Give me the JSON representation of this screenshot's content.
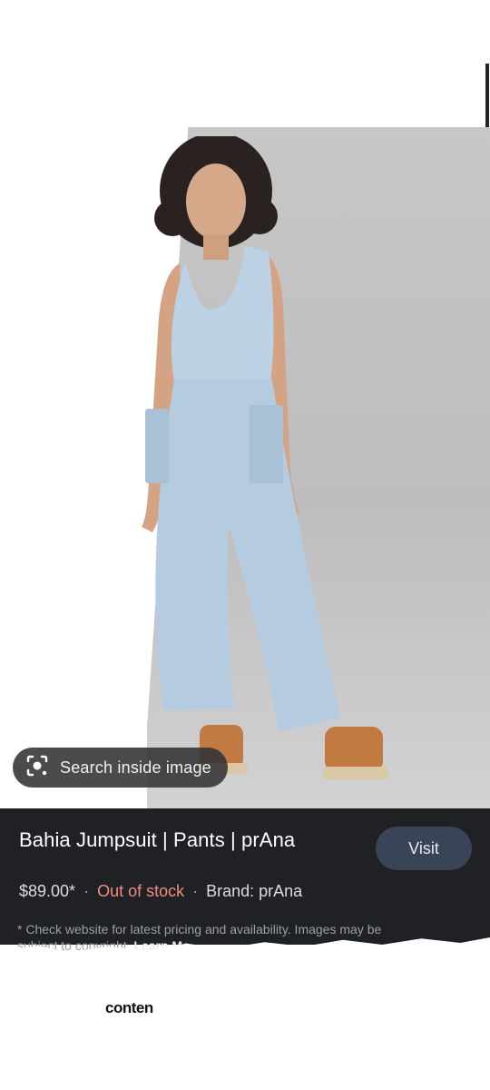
{
  "search_inside": {
    "label": "Search inside image",
    "icon": "lens-icon"
  },
  "product": {
    "title": "Bahia Jumpsuit | Pants | prAna",
    "price": "$89.00*",
    "stock": "Out of stock",
    "brand": "Brand: prAna",
    "visit_label": "Visit"
  },
  "disclaimer": {
    "line1": "* Check website for latest pricing and availability. Images may be",
    "line2": "subject to copyright.",
    "learn_more": "Learn Mo"
  },
  "stray_text": "conten",
  "colors": {
    "panel_bg": "#202124",
    "visit_bg": "#394457",
    "stock_red": "#f28b82",
    "jumpsuit_blue": "#b9cfe2"
  }
}
